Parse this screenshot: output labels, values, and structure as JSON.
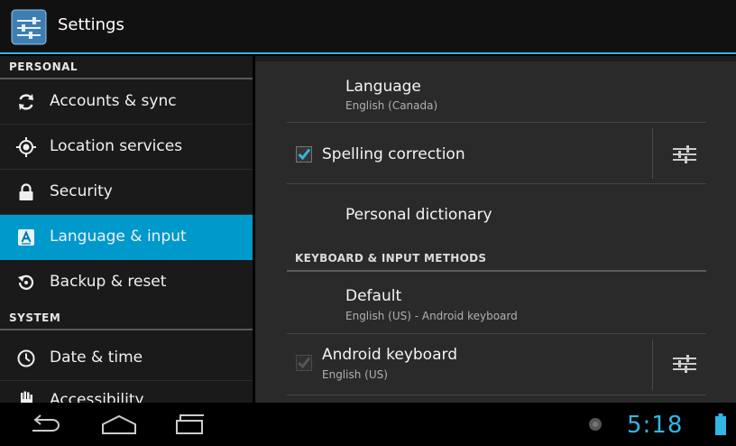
{
  "app": {
    "title": "Settings"
  },
  "sidebar": {
    "sections": [
      {
        "header": "PERSONAL"
      },
      {
        "header": "SYSTEM"
      }
    ],
    "items": [
      {
        "label": "Accounts & sync",
        "icon": "sync-icon"
      },
      {
        "label": "Location services",
        "icon": "location-icon"
      },
      {
        "label": "Security",
        "icon": "lock-icon"
      },
      {
        "label": "Language & input",
        "icon": "language-icon",
        "selected": true
      },
      {
        "label": "Backup & reset",
        "icon": "backup-icon"
      },
      {
        "label": "Date & time",
        "icon": "clock-icon"
      },
      {
        "label": "Accessibility",
        "icon": "hand-icon"
      }
    ]
  },
  "detail": {
    "language": {
      "title": "Language",
      "summary": "English (Canada)"
    },
    "spelling": {
      "title": "Spelling correction",
      "checked": true
    },
    "dictionary": {
      "title": "Personal dictionary"
    },
    "category": "KEYBOARD & INPUT METHODS",
    "default_method": {
      "title": "Default",
      "summary": "English (US) - Android keyboard"
    },
    "android_keyboard": {
      "title": "Android keyboard",
      "summary": "English (US)",
      "checked": true,
      "disabled": true
    }
  },
  "status": {
    "time": "5:18"
  },
  "colors": {
    "accent": "#33b5e5",
    "selected": "#0099cc"
  }
}
